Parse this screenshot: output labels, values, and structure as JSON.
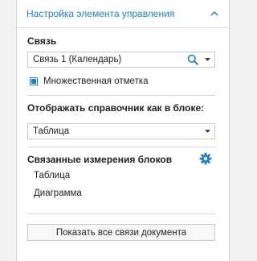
{
  "panel": {
    "title": "Настройка элемента управления",
    "collapse_icon": "chevron-up-icon"
  },
  "link_section": {
    "label": "Связь",
    "selected": "Связь 1 (Календарь)",
    "search_icon": "search-icon",
    "dropdown_icon": "chevron-down-icon"
  },
  "multi_select": {
    "label": "Множественная отметка",
    "checked": true
  },
  "display_section": {
    "label": "Отображать справочник как в блоке:",
    "selected": "Таблица"
  },
  "linked_dims": {
    "label": "Связанные измерения блоков",
    "settings_icon": "gear-icon",
    "items": [
      "Таблица",
      "Диаграмма"
    ]
  },
  "footer": {
    "show_all_label": "Показать все связи документа"
  },
  "colors": {
    "accent": "#1d7fc4",
    "border": "#c8c8c8",
    "background": "#f2f2f2"
  }
}
